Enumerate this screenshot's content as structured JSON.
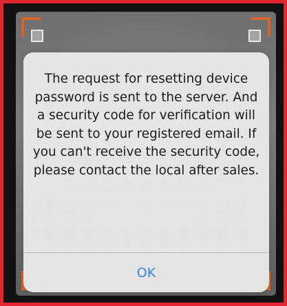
{
  "dialog": {
    "message": "The request for resetting device password is sent to the server. And a security code for verification will be sent to your registered email. If you can't receive the security code, please contact the local after sales.",
    "ok_label": "OK"
  },
  "colors": {
    "frame_border": "#e0262e",
    "scan_corner": "#d9642a",
    "ok_text": "#3a86d8",
    "dialog_bg": "#ececec"
  }
}
